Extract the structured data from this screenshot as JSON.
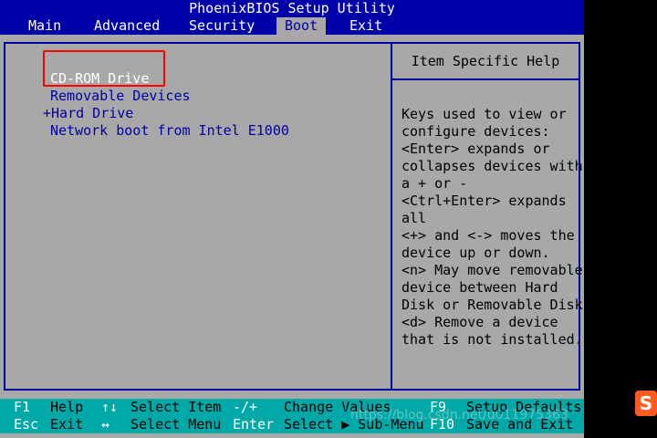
{
  "title": "PhoenixBIOS Setup Utility",
  "menu": {
    "items": [
      {
        "label": "Main"
      },
      {
        "label": "Advanced"
      },
      {
        "label": "Security"
      },
      {
        "label": "Boot"
      },
      {
        "label": "Exit"
      }
    ],
    "active": "Boot"
  },
  "boot_order": [
    {
      "label": "CD-ROM Drive",
      "selected": true
    },
    {
      "label": "Removable Devices",
      "selected": false
    },
    {
      "label": "+Hard Drive",
      "selected": false
    },
    {
      "label": "Network boot from Intel E1000",
      "selected": false
    }
  ],
  "help_panel": {
    "title": "Item Specific Help",
    "lines": [
      "Keys used to view or",
      "configure devices:",
      "<Enter> expands or",
      "collapses devices with",
      "a + or -",
      "<Ctrl+Enter> expands",
      "all",
      "<+> and <-> moves the",
      "device up or down.",
      "<n> May move removable",
      "device between Hard",
      "Disk or Removable Disk",
      "<d> Remove a device",
      "that is not installed."
    ]
  },
  "status_bar": {
    "row1": [
      {
        "key": "F1",
        "action": "Help"
      },
      {
        "key": "↑↓",
        "action": "Select Item"
      },
      {
        "key": "-/+",
        "action": "Change Values"
      },
      {
        "key": "F9",
        "action": "Setup Defaults"
      }
    ],
    "row2": [
      {
        "key": "Esc",
        "action": "Exit"
      },
      {
        "key": "↔",
        "action": "Select Menu"
      },
      {
        "key": "Enter",
        "action": "Select ▶ Sub-Menu"
      },
      {
        "key": "F10",
        "action": "Save and Exit"
      }
    ]
  },
  "watermark": "https://blog.csdn.net/u011975363",
  "logo_glyph": "S",
  "colors": {
    "bios_blue": "#0000a8",
    "bios_gray": "#a8a8a8",
    "status_cyan": "#00a8a8",
    "highlight_red": "#ff0000"
  }
}
